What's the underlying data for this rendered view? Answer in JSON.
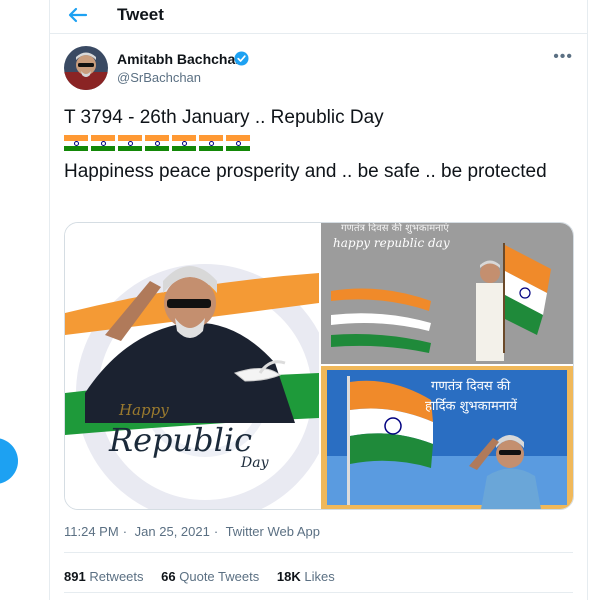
{
  "header": {
    "title": "Tweet",
    "back_icon": "arrow-left-icon"
  },
  "author": {
    "name": "Amitabh Bachchan",
    "handle": "@SrBachchan",
    "verified": true
  },
  "tweet": {
    "line1": "T 3794 - 26th January .. Republic Day",
    "flag_count": 7,
    "line2": "Happiness peace prosperity and .. be safe .. be protected"
  },
  "media": {
    "image1": {
      "text_happy": "Happy",
      "text_republic": "Republic",
      "text_day": "Day"
    },
    "image2": {
      "top_text": "गणतंत्र दिवस की शुभकामनाएं",
      "caption": "happy republic day"
    },
    "image3": {
      "line1": "गणतंत्र दिवस की",
      "line2": "हार्दिक शुभकामनायें"
    }
  },
  "meta": {
    "time": "11:24 PM",
    "separator": "·",
    "date": "Jan 25, 2021",
    "source": "Twitter Web App"
  },
  "stats": {
    "retweets_count": "891",
    "retweets_label": "Retweets",
    "quotes_count": "66",
    "quotes_label": "Quote Tweets",
    "likes_count": "18K",
    "likes_label": "Likes"
  },
  "colors": {
    "accent": "#1da1f2",
    "saffron": "#ff9933",
    "green": "#138808",
    "navy": "#000080"
  }
}
